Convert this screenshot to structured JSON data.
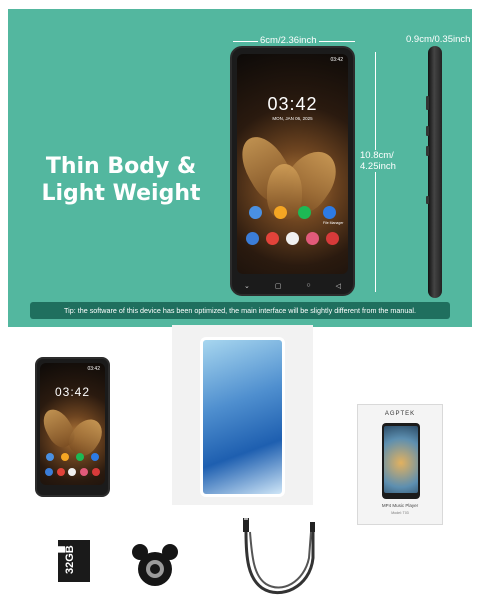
{
  "headline": {
    "line1": "Thin Body &",
    "line2": "Light Weight"
  },
  "dimensions": {
    "width": "6cm/2.36inch",
    "height": "10.8cm/ 4.25inch",
    "depth": "0.9cm/0.35inch"
  },
  "phone_screen": {
    "time": "03:42",
    "date": "MON, JAN 06, 2025",
    "status_time": "03:42",
    "app_label": "File Manager"
  },
  "small_phone_screen": {
    "time": "03:42",
    "status_time": "03:42"
  },
  "tip": "Tip: the software of this device has been optimized, the main interface will be slightly different from the manual.",
  "package_box": {
    "brand": "AGPTEK",
    "caption": "MP4 Music Player",
    "model": "Model: T03"
  },
  "sd_card": {
    "capacity": "32GB"
  },
  "colors": {
    "banner": "#53b79f",
    "tip_bg": "#1f6f5e"
  }
}
